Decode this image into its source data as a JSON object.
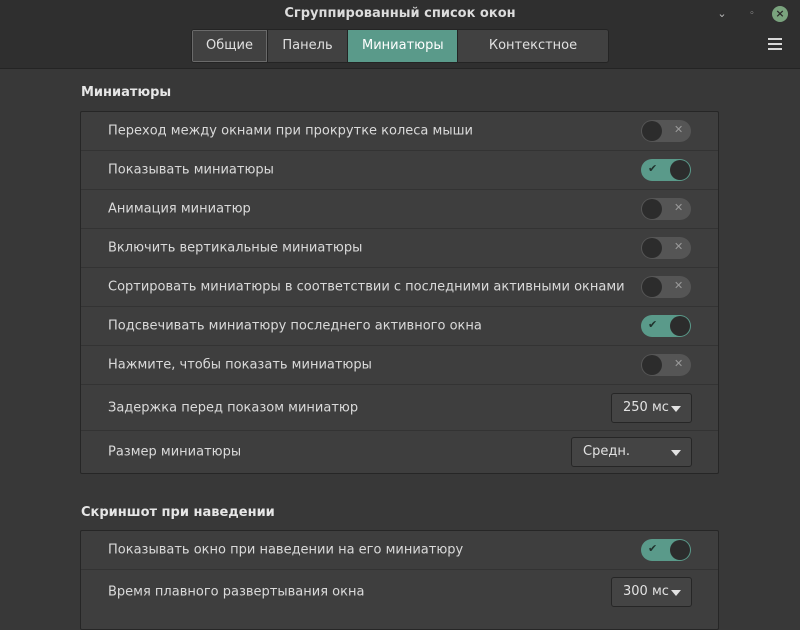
{
  "window": {
    "title": "Сгруппированный список окон",
    "minimize_label": "⌄",
    "maximize_label": "◦",
    "close_label": "×"
  },
  "tabs": [
    {
      "label": "Общие",
      "active": false
    },
    {
      "label": "Панель",
      "active": false
    },
    {
      "label": "Миниатюры",
      "active": true
    },
    {
      "label": "Контекстное меню",
      "active": false
    }
  ],
  "sections": {
    "thumbnails": {
      "title": "Миниатюры",
      "rows": [
        {
          "label": "Переход между окнами при прокрутке колеса мыши",
          "type": "switch",
          "state": "off"
        },
        {
          "label": "Показывать миниатюры",
          "type": "switch",
          "state": "on"
        },
        {
          "label": "Анимация миниатюр",
          "type": "switch",
          "state": "off"
        },
        {
          "label": "Включить вертикальные миниатюры",
          "type": "switch",
          "state": "off"
        },
        {
          "label": "Сортировать миниатюры в соответствии с последними активными окнами",
          "type": "switch",
          "state": "off"
        },
        {
          "label": "Подсвечивать миниатюру последнего активного окна",
          "type": "switch",
          "state": "on"
        },
        {
          "label": "Нажмите, чтобы показать миниатюры",
          "type": "switch",
          "state": "off"
        },
        {
          "label": "Задержка перед показом миниатюр",
          "type": "combo",
          "value": "250 мс"
        },
        {
          "label": "Размер миниатюры",
          "type": "combo",
          "value": "Средн."
        }
      ]
    },
    "hover": {
      "title": "Скриншот при наведении",
      "rows": [
        {
          "label": "Показывать окно при наведении на его миниатюру",
          "type": "switch",
          "state": "on"
        },
        {
          "label": "Время плавного развертывания окна",
          "type": "combo",
          "value": "300 мс"
        }
      ]
    }
  },
  "switch_marks": {
    "on": "✔",
    "off": "✕"
  },
  "colors": {
    "accent": "#5a9a8a",
    "background": "#383838",
    "panel": "#3e3e3e",
    "header": "#2f2f2f",
    "close": "#7aa37e"
  }
}
